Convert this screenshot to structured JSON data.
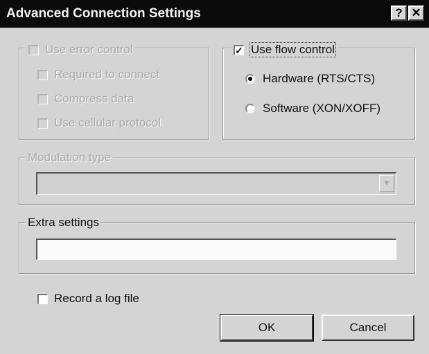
{
  "window": {
    "title": "Advanced Connection Settings",
    "help_glyph": "?",
    "close_glyph": "✕"
  },
  "error_control": {
    "label": "Use error control",
    "checked": false,
    "enabled": false,
    "options": [
      {
        "label": "Required to connect",
        "checked": false
      },
      {
        "label": "Compress data",
        "checked": false
      },
      {
        "label": "Use cellular protocol",
        "checked": false
      }
    ]
  },
  "flow_control": {
    "label": "Use flow control",
    "checked": true,
    "check_glyph": "✓",
    "options": [
      {
        "label": "Hardware (RTS/CTS)",
        "selected": true
      },
      {
        "label": "Software (XON/XOFF)",
        "selected": false
      }
    ]
  },
  "modulation": {
    "label": "Modulation type",
    "value": "",
    "arrow_glyph": "▼"
  },
  "extra": {
    "label": "Extra settings",
    "value": ""
  },
  "log": {
    "label": "Record a log file",
    "checked": false
  },
  "buttons": {
    "ok": "OK",
    "cancel": "Cancel"
  }
}
